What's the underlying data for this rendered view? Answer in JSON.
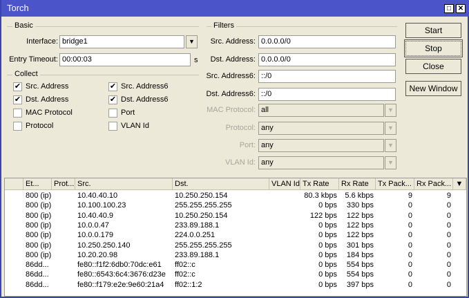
{
  "window": {
    "title": "Torch"
  },
  "basic": {
    "group": "Basic",
    "interface_label": "Interface:",
    "interface_value": "bridge1",
    "timeout_label": "Entry Timeout:",
    "timeout_value": "00:00:03",
    "timeout_unit": "s"
  },
  "collect": {
    "group": "Collect",
    "items": [
      {
        "label": "Src. Address",
        "checked": true
      },
      {
        "label": "Dst. Address",
        "checked": true
      },
      {
        "label": "MAC Protocol",
        "checked": false
      },
      {
        "label": "Protocol",
        "checked": false
      },
      {
        "label": "Src. Address6",
        "checked": true
      },
      {
        "label": "Dst. Address6",
        "checked": true
      },
      {
        "label": "Port",
        "checked": false
      },
      {
        "label": "VLAN Id",
        "checked": false
      }
    ]
  },
  "filters": {
    "group": "Filters",
    "fields": [
      {
        "label": "Src. Address:",
        "value": "0.0.0.0/0"
      },
      {
        "label": "Dst. Address:",
        "value": "0.0.0.0/0"
      },
      {
        "label": "Src. Address6:",
        "value": "::/0"
      },
      {
        "label": "Dst. Address6:",
        "value": "::/0"
      },
      {
        "label": "MAC Protocol:",
        "value": "all"
      },
      {
        "label": "Protocol:",
        "value": "any"
      },
      {
        "label": "Port:",
        "value": "any"
      },
      {
        "label": "VLAN Id:",
        "value": "any"
      }
    ]
  },
  "buttons": {
    "start": "Start",
    "stop": "Stop",
    "close": "Close",
    "new_window": "New Window"
  },
  "table": {
    "columns": [
      "Et...",
      "Prot...",
      "Src.",
      "Dst.",
      "VLAN Id",
      "Tx Rate",
      "Rx Rate",
      "Tx Pack...",
      "Rx Pack..."
    ],
    "rows": [
      [
        "800 (ip)",
        "",
        "10.40.40.10",
        "10.250.250.154",
        "",
        "80.3 kbps",
        "5.6 kbps",
        "9",
        "9"
      ],
      [
        "800 (ip)",
        "",
        "10.100.100.23",
        "255.255.255.255",
        "",
        "0 bps",
        "330 bps",
        "0",
        "0"
      ],
      [
        "800 (ip)",
        "",
        "10.40.40.9",
        "10.250.250.154",
        "",
        "122 bps",
        "122 bps",
        "0",
        "0"
      ],
      [
        "800 (ip)",
        "",
        "10.0.0.47",
        "233.89.188.1",
        "",
        "0 bps",
        "122 bps",
        "0",
        "0"
      ],
      [
        "800 (ip)",
        "",
        "10.0.0.179",
        "224.0.0.251",
        "",
        "0 bps",
        "122 bps",
        "0",
        "0"
      ],
      [
        "800 (ip)",
        "",
        "10.250.250.140",
        "255.255.255.255",
        "",
        "0 bps",
        "301 bps",
        "0",
        "0"
      ],
      [
        "800 (ip)",
        "",
        "10.20.20.98",
        "233.89.188.1",
        "",
        "0 bps",
        "184 bps",
        "0",
        "0"
      ],
      [
        "86dd...",
        "",
        "fe80::f1f2:6db0:70dc:e61",
        "ff02::c",
        "",
        "0 bps",
        "554 bps",
        "0",
        "0"
      ],
      [
        "86dd...",
        "",
        "fe80::6543:6c4:3676:d23e",
        "ff02::c",
        "",
        "0 bps",
        "554 bps",
        "0",
        "0"
      ],
      [
        "86dd...",
        "",
        "fe80::f179:e2e:9e60:21a4",
        "ff02::1:2",
        "",
        "0 bps",
        "397 bps",
        "0",
        "0"
      ]
    ]
  }
}
